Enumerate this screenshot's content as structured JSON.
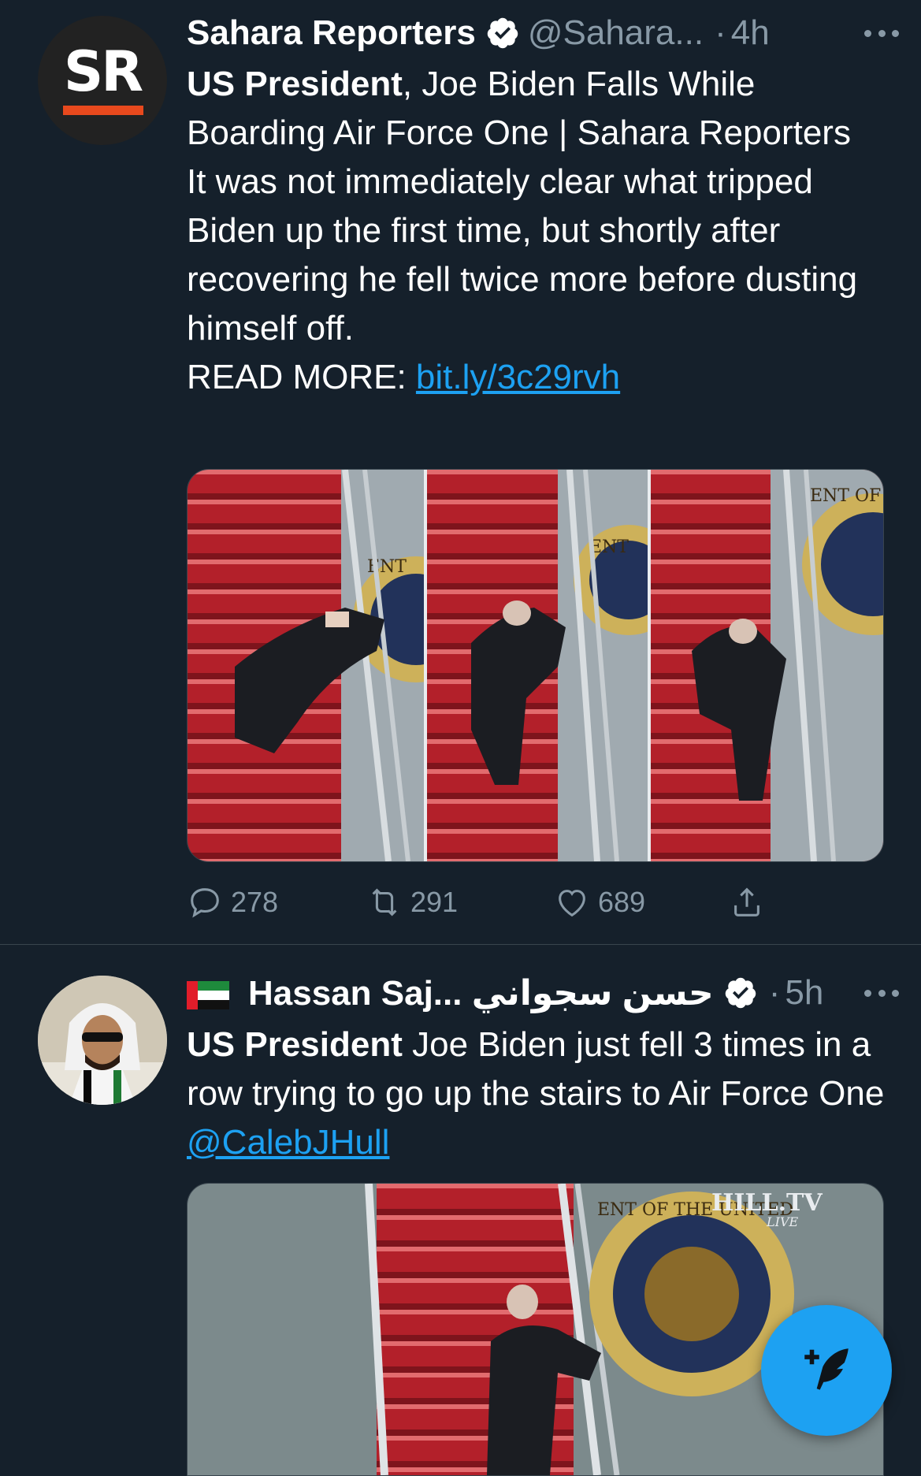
{
  "tweets": [
    {
      "author_name": "Sahara Reporters",
      "handle": "@Sahara...",
      "separator": "·",
      "time": "4h",
      "avatar_text": "SR",
      "text_bold": "US President",
      "text_rest": ", Joe Biden Falls While Boarding Air Force One | Sahara Reporters",
      "text_line2": "It was not immediately clear what tripped Biden up the first time, but shortly after recovering he fell twice more before dusting himself off.",
      "read_more_label": "READ MORE: ",
      "link": "bit.ly/3c29rvh",
      "media_overlay_left": "ENT",
      "media_overlay_mid": "ENT",
      "media_overlay_right": "ENT OF",
      "counts": {
        "replies": "278",
        "retweets": "291",
        "likes": "689"
      }
    },
    {
      "author_name": "Hassan Saj... حسن سجواني",
      "separator": "·",
      "time": "5h",
      "text_bold": "US President",
      "text_rest": " Joe Biden just fell 3 times in a row trying to go up the stairs to Air Force One ",
      "mention": "@CalebJHull",
      "media_watermark": "HILL.TV",
      "media_watermark_sub": "LIVE",
      "media_seal_text": "ENT OF THE UNITED"
    }
  ],
  "colors": {
    "background": "#15202b",
    "accent": "#1da1f2",
    "muted": "#8899a6",
    "divider": "#38444d",
    "sr_orange": "#e8491d"
  },
  "icons": [
    "verified-icon",
    "more-icon",
    "reply-icon",
    "retweet-icon",
    "like-icon",
    "share-icon",
    "compose-tweet-icon",
    "uae-flag-icon"
  ]
}
